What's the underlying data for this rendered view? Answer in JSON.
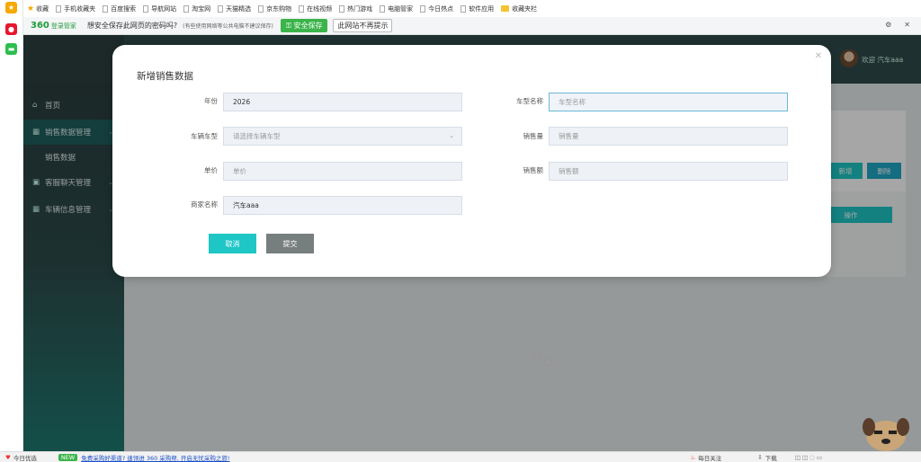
{
  "browser": {
    "bookmarks": [
      "收藏",
      "手机收藏夹",
      "百度搜索",
      "导航网站",
      "淘宝网",
      "天猫精选",
      "京东购物",
      "在线视频",
      "热门游戏",
      "电脑管家",
      "今日热点",
      "软件应用",
      "收藏夹栏"
    ],
    "password_bar": {
      "logo": "360",
      "logo_sub": "登录管家",
      "question": "想安全保存此网页的密码吗?",
      "note": "(有些使用网络等公共电脑不建议保存)",
      "save_label": "安全保存",
      "never_label": "此网站不再提示"
    },
    "status": {
      "left": "今日优选",
      "badge": "NEW",
      "hint": "免费采购好渠道? 速领进 360 采购帮, 开启无忧采购之旅!",
      "attention": "每日关注",
      "download": "下载"
    }
  },
  "sidebar": {
    "items": [
      {
        "label": "首页",
        "icon": "home-icon"
      },
      {
        "label": "销售数据管理",
        "icon": "grid-icon"
      },
      {
        "label": "销售数据",
        "icon": ""
      },
      {
        "label": "客服聊天管理",
        "icon": "chat-icon"
      },
      {
        "label": "车辆信息管理",
        "icon": "grid-icon"
      }
    ]
  },
  "header": {
    "welcome": "欢迎 汽车aaa"
  },
  "toolbar": {
    "add_label": "新增",
    "delete_label": "删除",
    "action_label": "操作"
  },
  "modal": {
    "title": "新增销售数据",
    "fields": {
      "year": {
        "label": "年份",
        "value": "2026"
      },
      "car_name": {
        "label": "车型名称",
        "placeholder": "车型名称"
      },
      "car_type": {
        "label": "车辆车型",
        "placeholder": "请选择车辆车型"
      },
      "sales_qty": {
        "label": "销售量",
        "placeholder": "销售量"
      },
      "unit_price": {
        "label": "单价",
        "placeholder": "单价"
      },
      "sales_amount": {
        "label": "销售额",
        "placeholder": "销售额"
      },
      "merchant": {
        "label": "商家名称",
        "value": "汽车aaa"
      }
    },
    "cancel_label": "取消",
    "submit_label": "提交"
  },
  "colors": {
    "accent": "#1fc6c6",
    "sidebar": "#2d4b4b",
    "submit": "#777e7e",
    "save_green": "#3bb44a"
  }
}
